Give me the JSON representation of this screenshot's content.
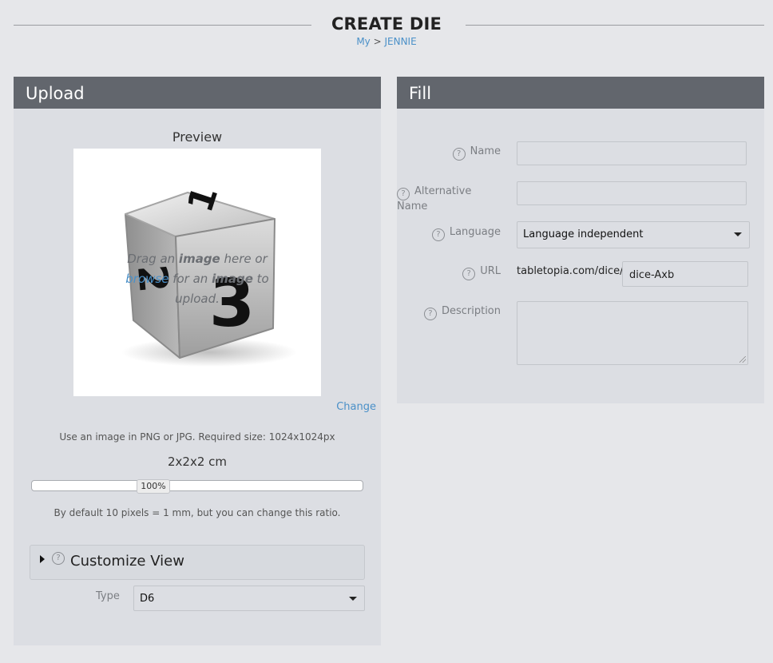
{
  "page": {
    "title": "CREATE DIE",
    "breadcrumb": {
      "root": "My",
      "separator": " > ",
      "current": "JENNIE"
    }
  },
  "upload": {
    "header": "Upload",
    "preview_label": "Preview",
    "drop": {
      "pre": "Drag an ",
      "bold1": "image",
      "mid": " here or ",
      "browse": "browse",
      "mid2": " for an ",
      "bold2": "image",
      "post": " to upload."
    },
    "change_link": "Change",
    "hint": "Use an image in PNG or JPG. Required size: 1024x1024px",
    "size": "2x2x2 cm",
    "slider_value": "100%",
    "slider_fraction": 0.34,
    "ratio_hint": "By default 10 pixels = 1 mm, but you can change this ratio.",
    "customize_label": "Customize View",
    "type_label": "Type",
    "type_value": "D6"
  },
  "fill": {
    "header": "Fill",
    "name_label": "Name",
    "name_value": "",
    "alt_name_label": "Alternative Name",
    "alt_name_value": "",
    "language_label": "Language",
    "language_value": "Language independent",
    "url_label": "URL",
    "url_prefix": "tabletopia.com/dice/",
    "url_value": "dice-Axb",
    "description_label": "Description",
    "description_value": ""
  },
  "die": {
    "top_face": "1",
    "front_face": "3",
    "side_face": "2"
  },
  "colors": {
    "accent": "#4a90c8",
    "header_bg": "#62666d",
    "panel_bg": "#dcdee3",
    "page_bg": "#e6e7ea"
  },
  "icons": {
    "help": "question-circle-icon",
    "expand": "triangle-right-icon",
    "dropdown": "caret-down-icon"
  }
}
